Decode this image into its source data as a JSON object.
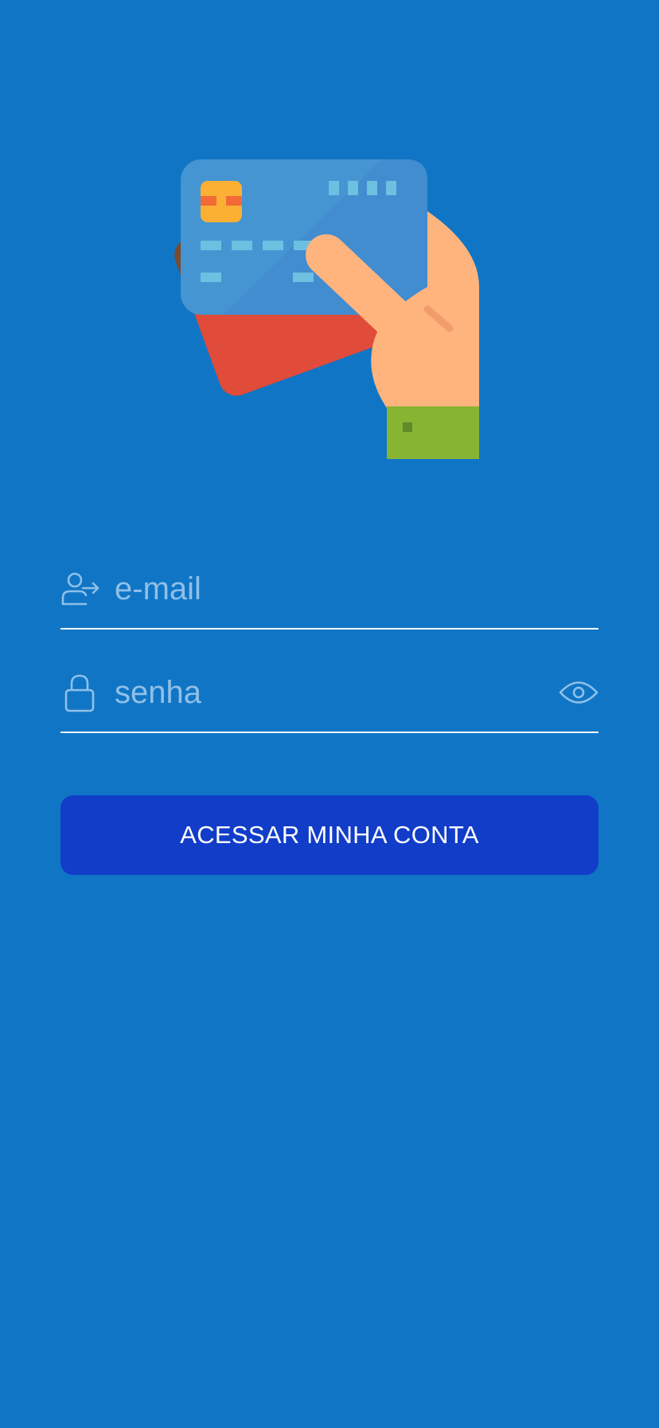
{
  "colors": {
    "background": "#1075c5",
    "button": "#113dc9",
    "underline": "#ffffff",
    "placeholder": "#8fc0e8"
  },
  "illustration": {
    "icon": "hand-holding-credit-cards-illustration"
  },
  "login_form": {
    "email": {
      "placeholder": "e-mail",
      "value": "",
      "icon": "user-arrow-icon"
    },
    "password": {
      "placeholder": "senha",
      "value": "",
      "icon": "lock-icon",
      "toggle_icon": "eye-icon"
    },
    "submit_label": "ACESSAR MINHA CONTA"
  }
}
